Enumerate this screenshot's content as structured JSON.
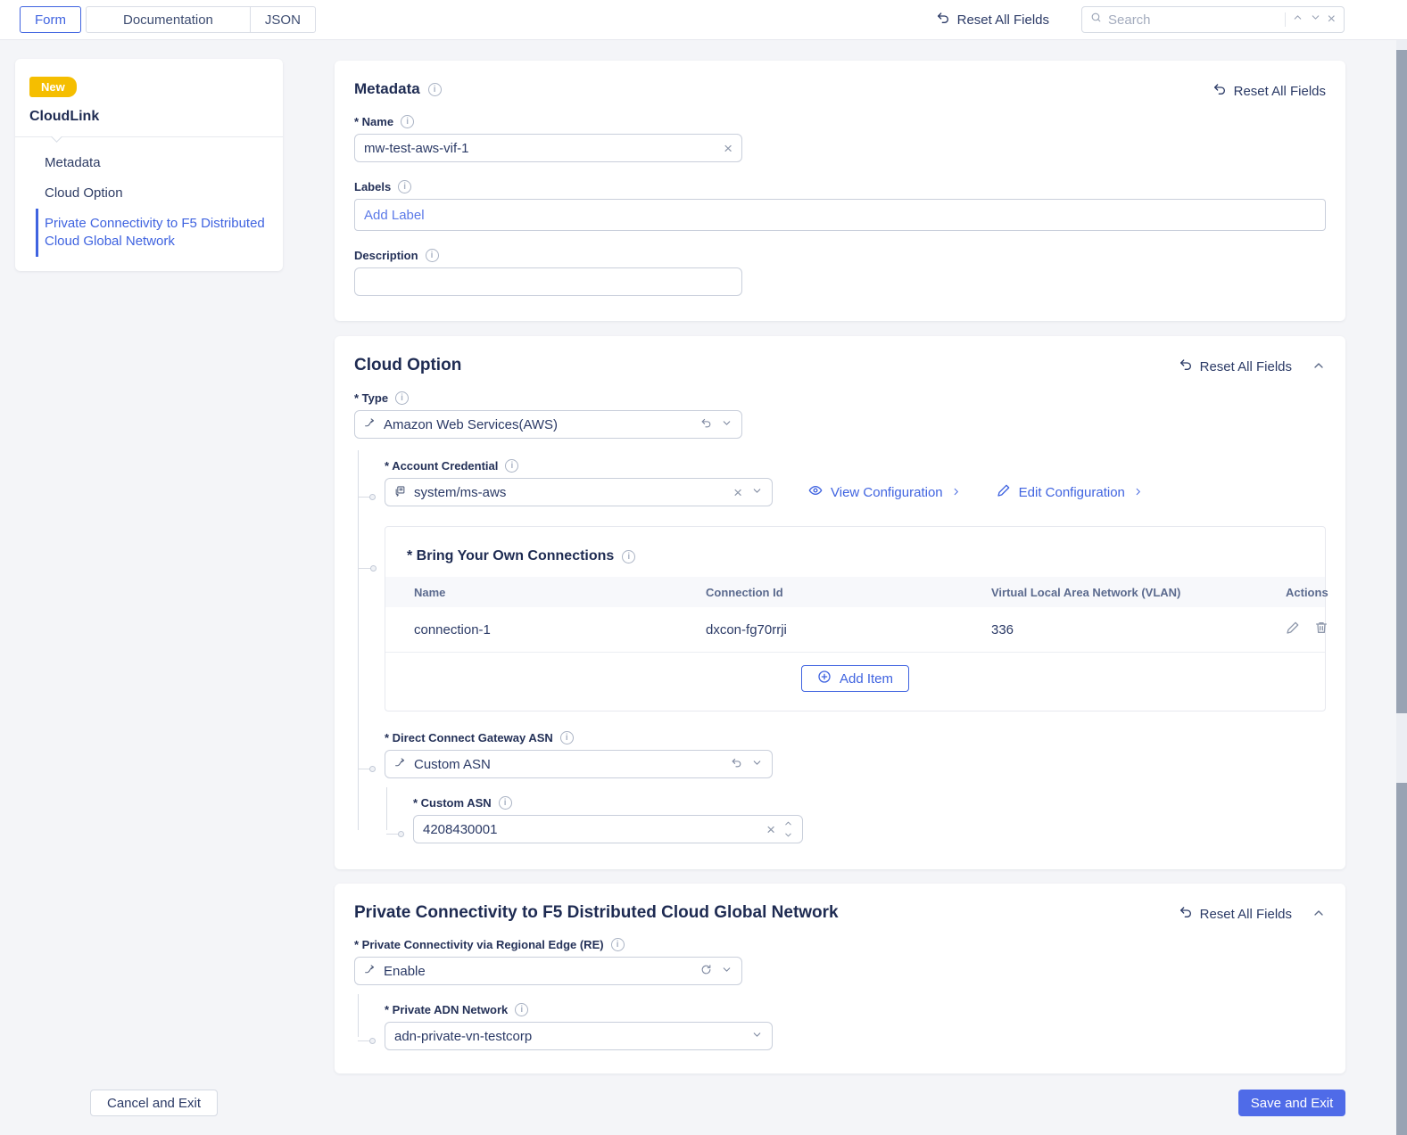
{
  "topbar": {
    "tabs": [
      {
        "label": "Form",
        "active": true
      },
      {
        "label": "Documentation",
        "active": false
      },
      {
        "label": "JSON",
        "active": false
      }
    ],
    "reset_all_label": "Reset All Fields",
    "search": {
      "placeholder": "Search"
    }
  },
  "sidebar": {
    "badge": "New",
    "title": "CloudLink",
    "items": [
      {
        "label": "Metadata",
        "active": false
      },
      {
        "label": "Cloud Option",
        "active": false
      },
      {
        "label": "Private Connectivity to F5 Distributed Cloud Global Network",
        "active": true
      }
    ]
  },
  "metadata_section": {
    "title": "Metadata",
    "reset_label": "Reset All Fields",
    "name": {
      "label": "* Name",
      "value": "mw-test-aws-vif-1"
    },
    "labels": {
      "label": "Labels",
      "placeholder": "Add Label"
    },
    "description": {
      "label": "Description",
      "value": ""
    }
  },
  "cloud_option_section": {
    "title": "Cloud Option",
    "reset_label": "Reset All Fields",
    "type": {
      "label": "* Type",
      "value": "Amazon Web Services(AWS)"
    },
    "account_credential": {
      "label": "* Account Credential",
      "value": "system/ms-aws"
    },
    "view_configuration_label": "View Configuration",
    "edit_configuration_label": "Edit Configuration",
    "byoc": {
      "title": "* Bring Your Own Connections",
      "headers": [
        "Name",
        "Connection Id",
        "Virtual Local Area Network (VLAN)",
        "Actions"
      ],
      "rows": [
        {
          "name": "connection-1",
          "connection_id": "dxcon-fg70rrji",
          "vlan": "336"
        }
      ],
      "add_item_label": "Add Item"
    },
    "direct_connect_gateway_asn": {
      "label": "* Direct Connect Gateway ASN",
      "value": "Custom ASN"
    },
    "custom_asn": {
      "label": "* Custom ASN",
      "value": "4208430001"
    }
  },
  "private_connectivity_section": {
    "title": "Private Connectivity to F5 Distributed Cloud Global Network",
    "reset_label": "Reset All Fields",
    "regional_edge": {
      "label": "* Private Connectivity via Regional Edge (RE)",
      "value": "Enable"
    },
    "private_adn_network": {
      "label": "* Private ADN Network",
      "value": "adn-private-vn-testcorp"
    }
  },
  "footer": {
    "cancel_label": "Cancel and Exit",
    "save_label": "Save and Exit"
  },
  "glyphs": {
    "clear": "×",
    "info": "i"
  },
  "colors": {
    "accent": "#3F63E0",
    "badge": "#F5BE00",
    "save_button": "#4F6BE8",
    "text_navy": "#243158"
  }
}
